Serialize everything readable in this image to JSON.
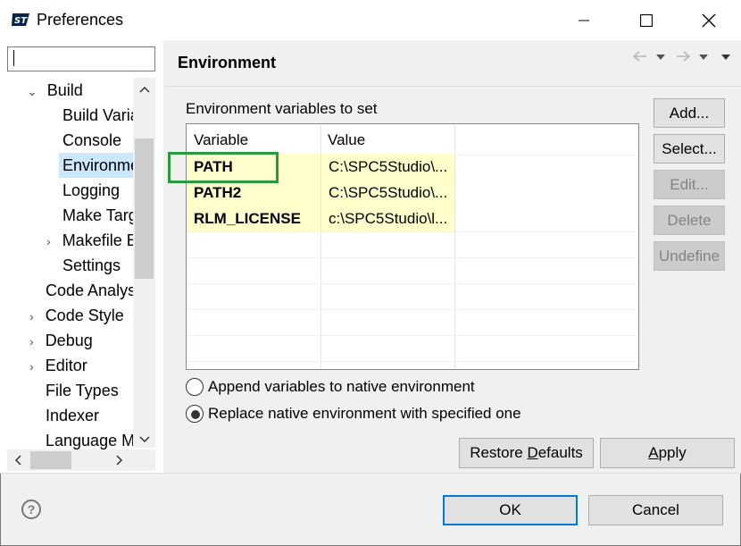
{
  "window": {
    "title": "Preferences",
    "minimize_icon": "minimize-icon",
    "maximize_icon": "maximize-icon",
    "close_icon": "close-icon"
  },
  "sidebar": {
    "filter_value": "",
    "items": [
      {
        "label": "Build",
        "expand": "open"
      },
      {
        "label": "Build Varia"
      },
      {
        "label": "Console"
      },
      {
        "label": "Environme",
        "selected": true
      },
      {
        "label": "Logging"
      },
      {
        "label": "Make Targ"
      },
      {
        "label": "Makefile E",
        "expand": "closed"
      },
      {
        "label": "Settings"
      },
      {
        "label": "Code Analys"
      },
      {
        "label": "Code Style",
        "expand": "closed"
      },
      {
        "label": "Debug",
        "expand": "closed"
      },
      {
        "label": "Editor",
        "expand": "closed"
      },
      {
        "label": "File Types"
      },
      {
        "label": "Indexer"
      },
      {
        "label": "Language M"
      }
    ]
  },
  "main": {
    "title": "Environment",
    "table_label": "Environment variables to set",
    "columns": [
      "Variable",
      "Value"
    ],
    "rows": [
      {
        "variable": "PATH",
        "value": "C:\\SPC5Studio\\..."
      },
      {
        "variable": "PATH2",
        "value": "C:\\SPC5Studio\\..."
      },
      {
        "variable": "RLM_LICENSE",
        "value": "c:\\SPC5Studio\\l..."
      }
    ],
    "buttons": {
      "add": "Add...",
      "select": "Select...",
      "edit": "Edit...",
      "delete": "Delete",
      "undefine": "Undefine"
    },
    "radio_append": "Append variables to native environment",
    "radio_replace": "Replace native environment with specified one",
    "restore_defaults_pre": "Restore ",
    "restore_defaults_u": "D",
    "restore_defaults_post": "efaults",
    "apply_u": "A",
    "apply_post": "pply"
  },
  "footer": {
    "ok": "OK",
    "cancel": "Cancel",
    "help_glyph": "?"
  },
  "colors": {
    "highlight_box": "#2b9a3e",
    "row_background": "#ffffcc",
    "selection": "#cce8ff"
  }
}
